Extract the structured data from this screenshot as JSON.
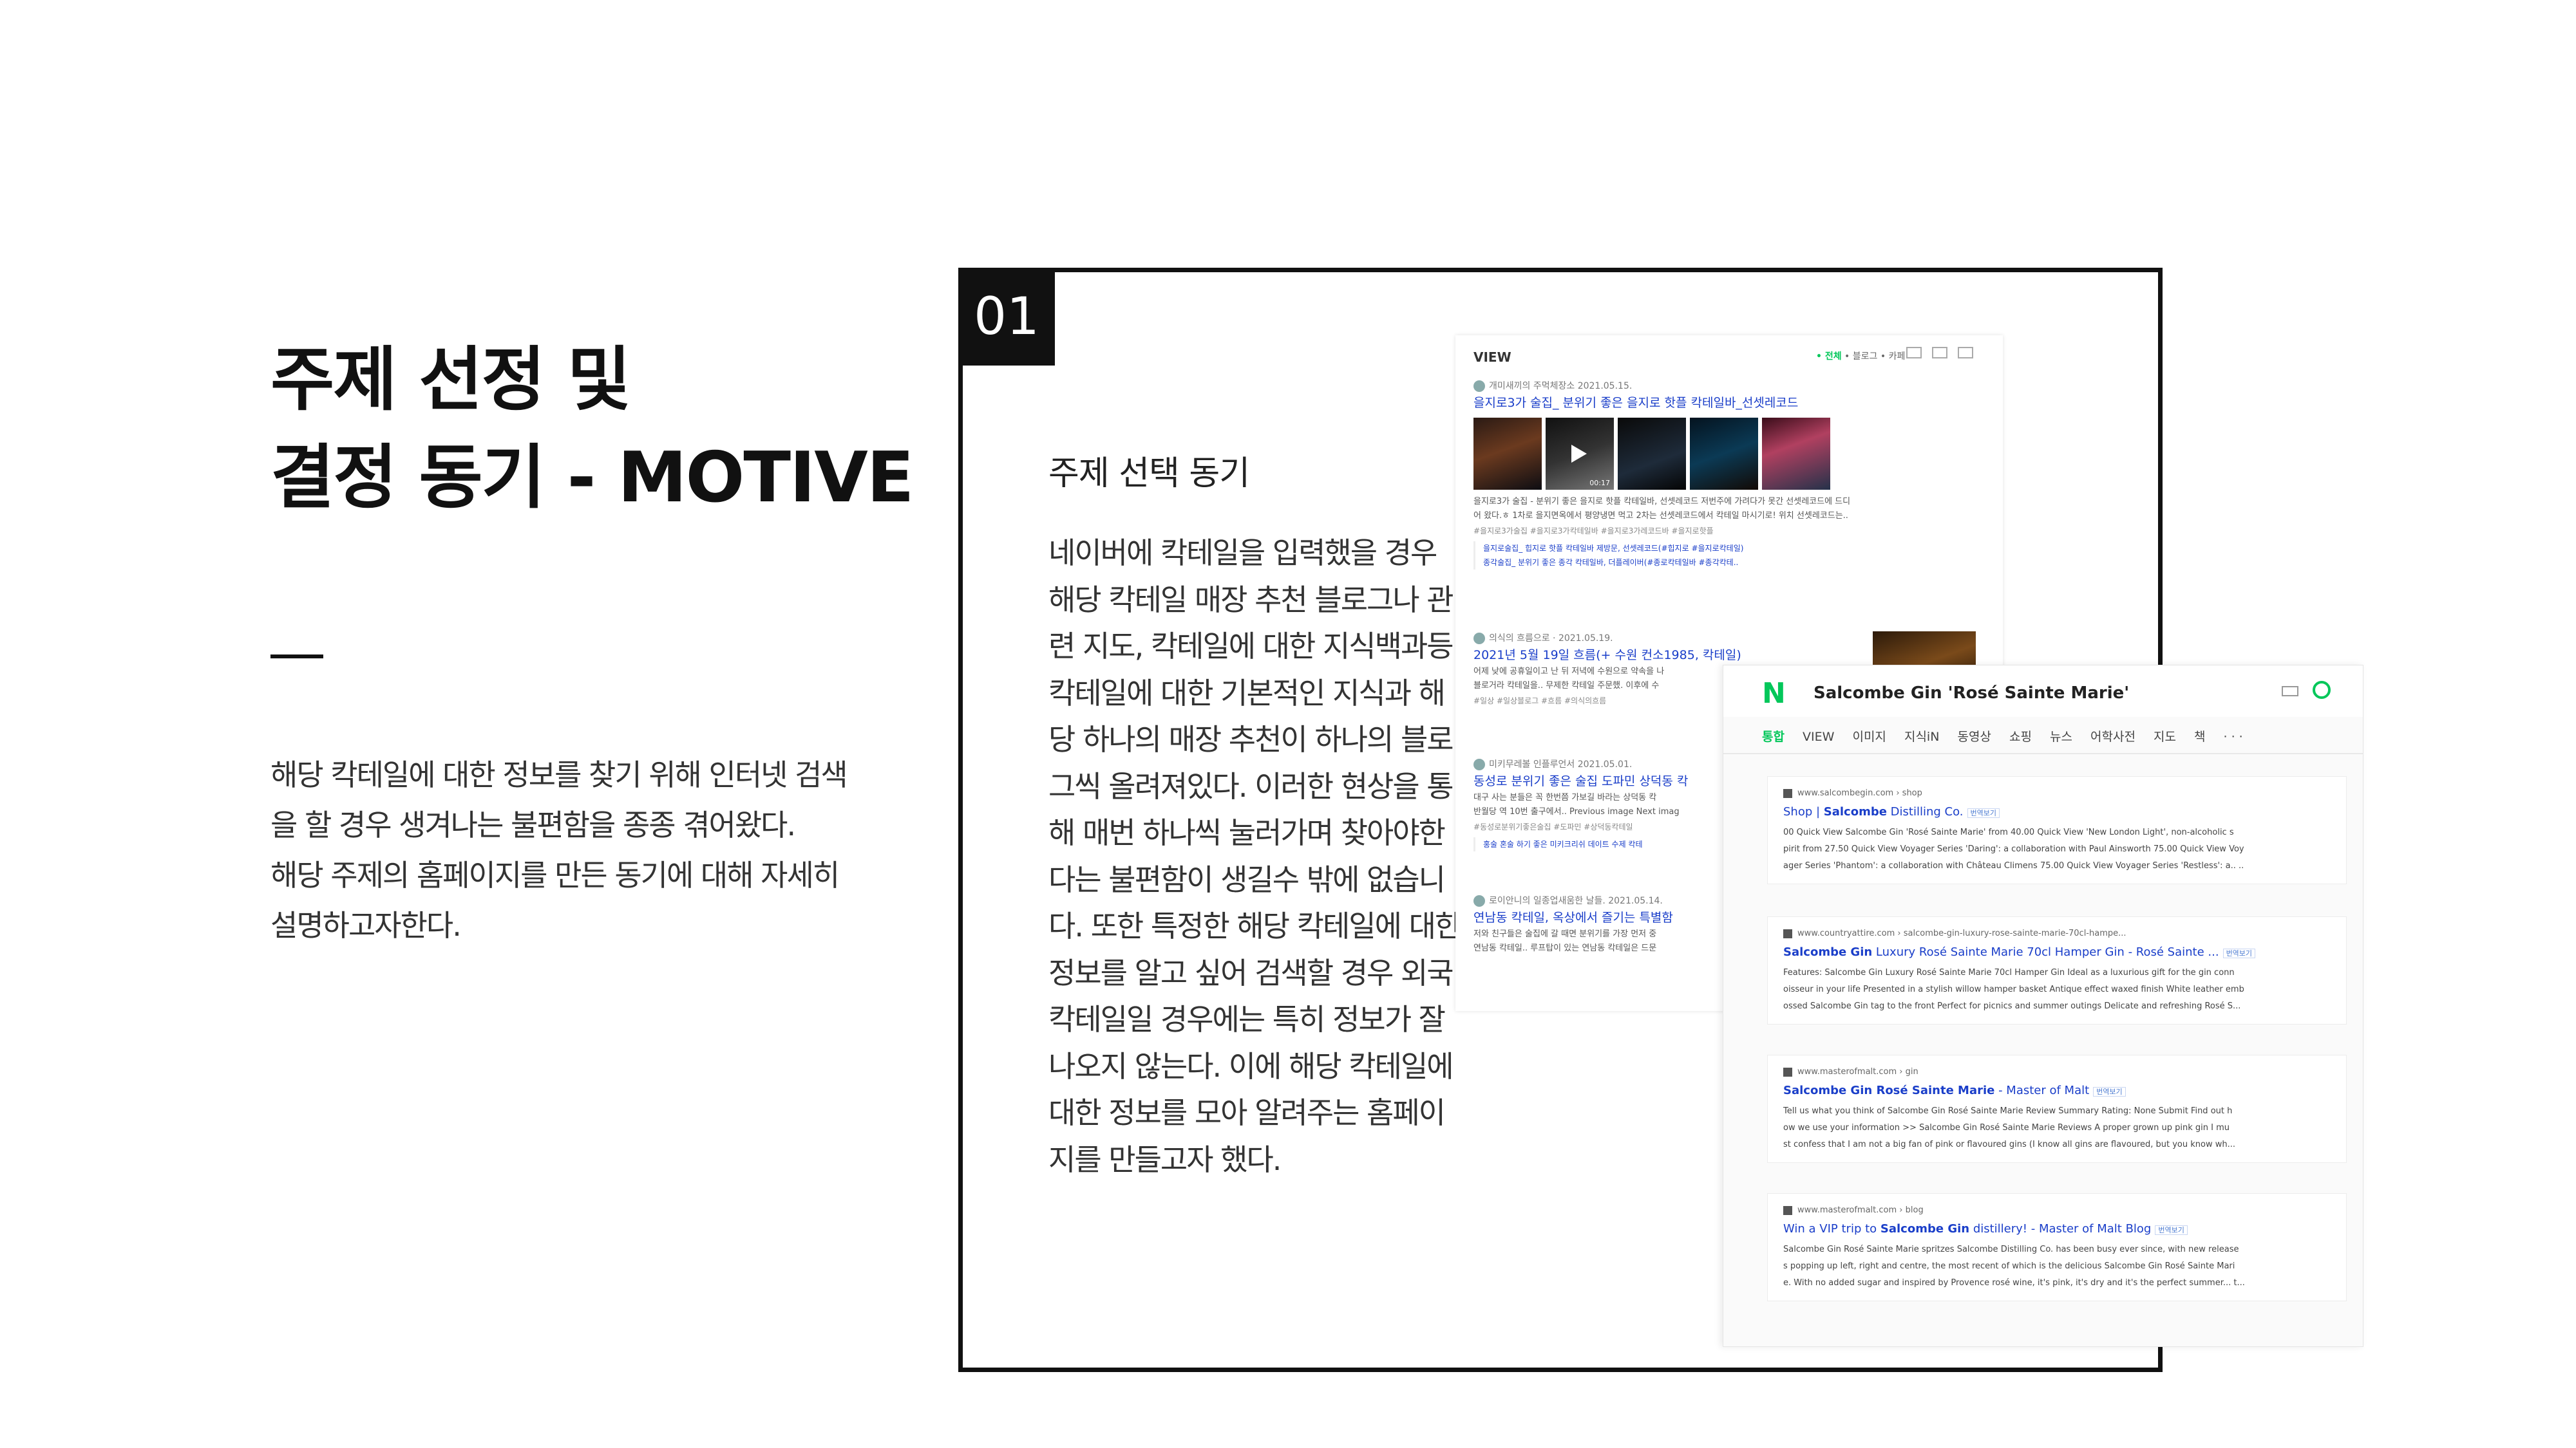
{
  "page": {
    "title_lines": [
      "주제 선정 및",
      "결정 동기 - MOTIVE"
    ],
    "desc_lines": [
      "해당 칵테일에 대한 정보를 찾기 위해 인터넷 검색",
      "을 할 경우 생겨나는 불편함을 종종 겪어왔다.",
      "해당 주제의 홈페이지를 만든 동기에 대해 자세히",
      "설명하고자한다."
    ]
  },
  "panel": {
    "number": "01",
    "heading": "주제 선택 동기",
    "body_lines": [
      "네이버에 칵테일을 입력했을 경우",
      "해당 칵테일 매장 추천 블로그나 관",
      "련 지도, 칵테일에 대한 지식백과등",
      "칵테일에 대한 기본적인 지식과 해",
      "당 하나의 매장 추천이 하나의 블로",
      "그씩 올려져있다. 이러한 현상을 통",
      "해 매번 하나씩 눌러가며 찾아야한",
      "다는 불편함이 생길수 밖에 없습니",
      "다. 또한 특정한 해당 칵테일에 대한",
      "정보를 알고 싶어 검색할 경우 외국",
      "칵테일일 경우에는 특히 정보가 잘",
      "나오지 않는다. 이에 해당 칵테일에",
      "대한 정보를 모아 알려주는 홈페이",
      "지를 만들고자 했다."
    ]
  },
  "naver_view": {
    "header": "VIEW",
    "filters": [
      "• 전체",
      "• 블로그",
      "• 카페"
    ],
    "post1": {
      "meta": "개미새끼의 주먹체장소   2021.05.15.",
      "title": "을지로3가 술집_ 분위기 좋은 을지로 핫플 칵테일바_선셋레코드",
      "snippet1": "을지로3가 술집 - 분위기 좋은 을지로 핫플 칵테일바, 선셋레코드 저번주에 가려다가 못간 선셋레코드에 드디",
      "snippet2": "어 왔다.ㅎ 1차로 을지면옥에서 평양냉면 먹고 2차는 선셋레코드에서 칵테일 마시기로! 위치 선셋레코드는..",
      "tags": "#을지로3가술집    #을지로3가칵테일바    #을지로3가레코드바    #을지로핫플",
      "sub1": "을지로술집_ 힙지로 핫플 칵테일바 제방문, 선셋레코드(#힙지로 #을지로칵테일)",
      "sub2": "종각술집_ 분위기 좋은 종각 칵테일바, 더플레이버(#종로칵테일바 #종각칵테..",
      "video_time": "00:17"
    },
    "post2": {
      "meta": "의식의 흐름으로 ·   2021.05.19.",
      "title": "2021년 5월 19일 흐름(+ 수원 컨소1985, 칵테일)",
      "snippet1": "어제 낮에 공휴일이고 난 뒤 저녁에 수원으로 약속을 나",
      "snippet2": "블로거라 칵테일을.. 무제한 칵테일 주문했. 이후에 수",
      "tags": "#일상    #일상블로그    #흐름    #의식의흐름"
    },
    "post3": {
      "meta": "미키무레볼   인플루언서   2021.05.01.",
      "title": "동성로 분위기 좋은 술집 도파민 상덕동 칵",
      "snippet1": "대구 사는 분들은 꼭 한번쯤 가보길 바라는 상덕동 칵",
      "snippet2": "반월당 역 10번 출구에서.. Previous image Next imag",
      "tags": "#동성로분위기좋은술집    #도파민    #상덕동칵테일",
      "sub1": "홍술 혼술 하기 좋은 미키크리쉬 데이트 수제 칵테"
    },
    "post4": {
      "meta": "로이안니의 일종업새움한 날들.   2021.05.14.",
      "title": "연남동 칵테일, 옥상에서 즐기는 특별함",
      "snippet1": "저와 친구들은 술집에 갈 때면 분위기를 가장 먼저 중",
      "snippet2": "연남동 칵테일.. 루프탑이 있는 연남동 칵테일은 드문"
    }
  },
  "english_search": {
    "logo": "N",
    "query": "Salcombe Gin 'Rosé Sainte Marie'",
    "tabs": [
      "통합",
      "VIEW",
      "이미지",
      "지식iN",
      "동영상",
      "쇼핑",
      "뉴스",
      "어학사전",
      "지도",
      "책",
      "· · ·"
    ],
    "translate_label": "번역보기",
    "results": [
      {
        "source": "www.salcombegin.com › shop",
        "title_pre": "Shop | ",
        "title_bold": "Salcombe",
        "title_post": " Distilling Co.",
        "lines": [
          "00 Quick View Salcombe Gin 'Rosé Sainte Marie' from 40.00 Quick View 'New London Light', non-alcoholic s",
          "pirit from 27.50 Quick View Voyager Series 'Daring': a collaboration with Paul Ainsworth 75.00 Quick View Voy",
          "ager Series 'Phantom': a collaboration with Château Climens 75.00 Quick View Voyager Series 'Restless': a.. .."
        ]
      },
      {
        "source": "www.countryattire.com › salcombe-gin-luxury-rose-sainte-marie-70cl-hampe...",
        "title_pre": "",
        "title_bold": "Salcombe Gin",
        "title_post": " Luxury Rosé Sainte Marie 70cl Hamper Gin - Rosé Sainte ...",
        "lines": [
          "Features: Salcombe Gin Luxury Rosé Sainte Marie 70cl Hamper Gin Ideal as a luxurious gift for the gin conn",
          "oisseur in your life Presented in a stylish willow hamper basket Antique effect waxed finish White leather emb",
          "ossed Salcombe Gin tag to the front Perfect for picnics and summer outings Delicate and refreshing Rosé S..."
        ]
      },
      {
        "source": "www.masterofmalt.com › gin",
        "title_pre": "",
        "title_bold": "Salcombe Gin Rosé Sainte Marie",
        "title_post": " - Master of Malt",
        "lines": [
          "Tell us what you think of Salcombe Gin Rosé Sainte Marie Review Summary Rating: None Submit Find out h",
          "ow we use your information >> Salcombe Gin Rosé Sainte Marie Reviews A proper grown up pink gin I mu",
          "st confess that I am not a big fan of pink or flavoured gins (I know all gins are flavoured, but you know wh..."
        ]
      },
      {
        "source": "www.masterofmalt.com › blog",
        "title_pre": "Win a VIP trip to ",
        "title_bold": "Salcombe Gin",
        "title_post": " distillery! - Master of Malt Blog",
        "lines": [
          "Salcombe Gin Rosé Sainte Marie spritzes Salcombe Distilling Co. has been busy ever since, with new release",
          "s popping up left, right and centre, the most recent of which is the delicious Salcombe Gin Rosé Sainte Mari",
          "e. With no added sugar and inspired by Provence rosé wine, it's pink, it's dry and it's the perfect summer... t..."
        ]
      }
    ]
  }
}
